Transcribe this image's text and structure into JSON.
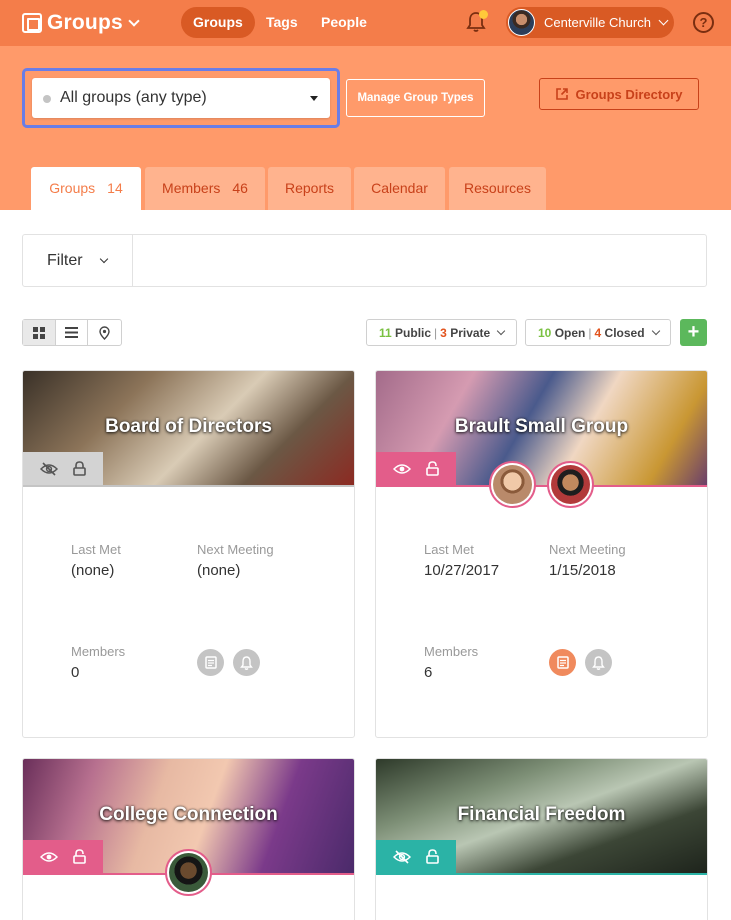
{
  "nav": {
    "brand": "Groups",
    "items": [
      {
        "label": "Groups",
        "active": true
      },
      {
        "label": "Tags",
        "active": false
      },
      {
        "label": "People",
        "active": false
      }
    ],
    "account_name": "Centerville Church",
    "help_label": "?"
  },
  "header": {
    "group_type_select": "All groups (any type)",
    "manage_button": "Manage Group Types",
    "directory_button": "Groups Directory"
  },
  "tabs": [
    {
      "label": "Groups",
      "count": "14",
      "active": true
    },
    {
      "label": "Members",
      "count": "46",
      "active": false
    },
    {
      "label": "Reports",
      "count": "",
      "active": false
    },
    {
      "label": "Calendar",
      "count": "",
      "active": false
    },
    {
      "label": "Resources",
      "count": "",
      "active": false
    }
  ],
  "filter": {
    "label": "Filter",
    "search_value": ""
  },
  "toolbar": {
    "visibility": {
      "public_count": "11",
      "public_label": "Public",
      "private_count": "3",
      "private_label": "Private"
    },
    "status": {
      "open_count": "10",
      "open_label": "Open",
      "closed_count": "4",
      "closed_label": "Closed"
    },
    "add_label": "+"
  },
  "cards": [
    {
      "title": "Board of Directors",
      "visibility": "private",
      "labels": {
        "last_met": "Last Met",
        "next_meeting": "Next Meeting",
        "members": "Members"
      },
      "last_met": "(none)",
      "next_meeting": "(none)",
      "members": "0",
      "accent": "#c4c4c4"
    },
    {
      "title": "Brault Small Group",
      "visibility": "public",
      "labels": {
        "last_met": "Last Met",
        "next_meeting": "Next Meeting",
        "members": "Members"
      },
      "last_met": "10/27/2017",
      "next_meeting": "1/15/2018",
      "members": "6",
      "accent": "#e35d8a"
    },
    {
      "title": "College Connection",
      "visibility": "public",
      "accent": "#e35d8a"
    },
    {
      "title": "Financial Freedom",
      "visibility": "private",
      "accent": "#2bb3a6"
    }
  ],
  "colors": {
    "brand": "#f47d4a",
    "header_band": "#ff9a6a",
    "active_pill": "#d95a24",
    "link_red": "#c8411a",
    "pink": "#e35d8a",
    "teal": "#2bb3a6",
    "green": "#5cb85c"
  }
}
